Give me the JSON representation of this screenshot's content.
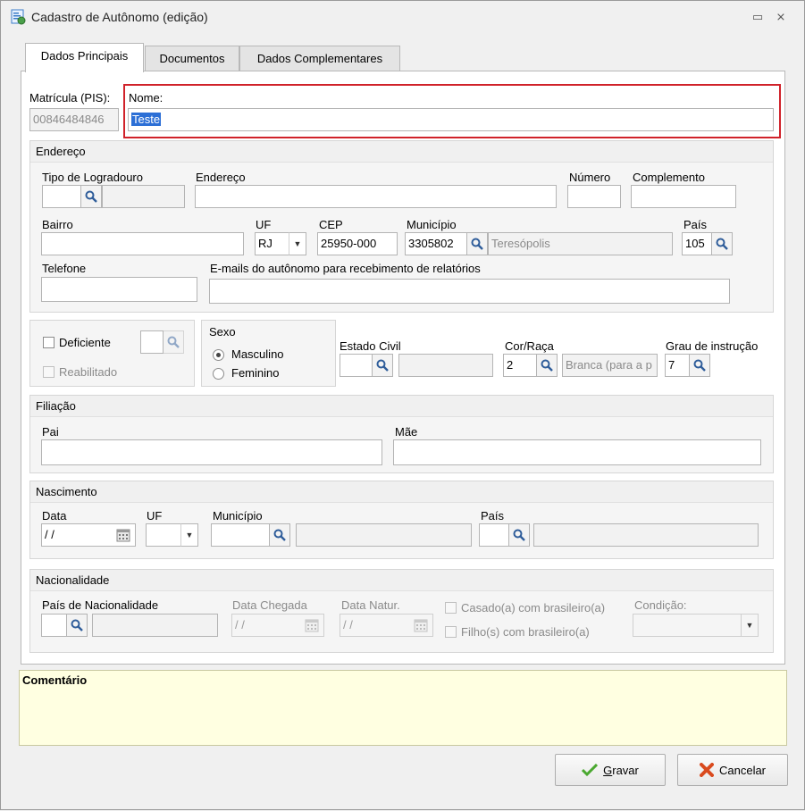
{
  "window": {
    "title": "Cadastro de Autônomo (edição)",
    "min_glyph": "▭",
    "close_glyph": "⨯"
  },
  "tabs": [
    {
      "label": "Dados Principais",
      "active": true
    },
    {
      "label": "Documentos",
      "active": false
    },
    {
      "label": "Dados Complementares",
      "active": false
    }
  ],
  "matricula": {
    "label": "Matrícula (PIS):",
    "value": "00846484846"
  },
  "nome": {
    "label": "Nome:",
    "value": "Teste"
  },
  "endereco": {
    "title": "Endereço",
    "tipo_logradouro": {
      "label": "Tipo de Logradouro",
      "value": "",
      "desc": ""
    },
    "endereco": {
      "label": "Endereço",
      "value": ""
    },
    "numero": {
      "label": "Número",
      "value": ""
    },
    "complemento": {
      "label": "Complemento",
      "value": ""
    },
    "bairro": {
      "label": "Bairro",
      "value": ""
    },
    "uf": {
      "label": "UF",
      "value": "RJ"
    },
    "cep": {
      "label": "CEP",
      "value": "25950-000"
    },
    "municipio": {
      "label": "Município",
      "code": "3305802",
      "desc": "Teresópolis"
    },
    "pais": {
      "label": "País",
      "value": "105"
    },
    "telefone": {
      "label": "Telefone",
      "value": ""
    },
    "emails": {
      "label": "E-mails do autônomo para recebimento de relatórios",
      "value": ""
    }
  },
  "deficiencia": {
    "deficiente_label": "Deficiente",
    "reabilitado_label": "Reabilitado",
    "code": ""
  },
  "sexo": {
    "title": "Sexo",
    "masculino": "Masculino",
    "feminino": "Feminino",
    "selected": "Masculino"
  },
  "estado_civil": {
    "label": "Estado Civil",
    "code": "",
    "desc": ""
  },
  "cor_raca": {
    "label": "Cor/Raça",
    "code": "2",
    "desc": "Branca (para a p"
  },
  "grau_instrucao": {
    "label": "Grau de instrução",
    "code": "7"
  },
  "filiacao": {
    "title": "Filiação",
    "pai": {
      "label": "Pai",
      "value": ""
    },
    "mae": {
      "label": "Mãe",
      "value": ""
    }
  },
  "nascimento": {
    "title": "Nascimento",
    "data": {
      "label": "Data",
      "value": " / /"
    },
    "uf": {
      "label": "UF",
      "value": ""
    },
    "municipio": {
      "label": "Município",
      "code": "",
      "desc": ""
    },
    "pais": {
      "label": "País",
      "code": "",
      "desc": ""
    }
  },
  "nacionalidade": {
    "title": "Nacionalidade",
    "pais_nacionalidade": {
      "label": "País de Nacionalidade",
      "code": "",
      "desc": ""
    },
    "data_chegada": {
      "label": "Data Chegada",
      "value": " / /"
    },
    "data_natur": {
      "label": "Data Natur.",
      "value": " / /"
    },
    "casado_label": "Casado(a) com brasileiro(a)",
    "filhos_label": "Filho(s) com brasileiro(a)",
    "condicao": {
      "label": "Condição:",
      "value": ""
    }
  },
  "comentario": {
    "title": "Comentário",
    "value": ""
  },
  "buttons": {
    "gravar_prefix": "",
    "gravar_underlined": "G",
    "gravar_rest": "ravar",
    "cancelar": "Cancelar"
  },
  "colors": {
    "highlight": "#d0222a",
    "selection": "#2c6fd6",
    "comment_bg": "#ffffe1"
  }
}
